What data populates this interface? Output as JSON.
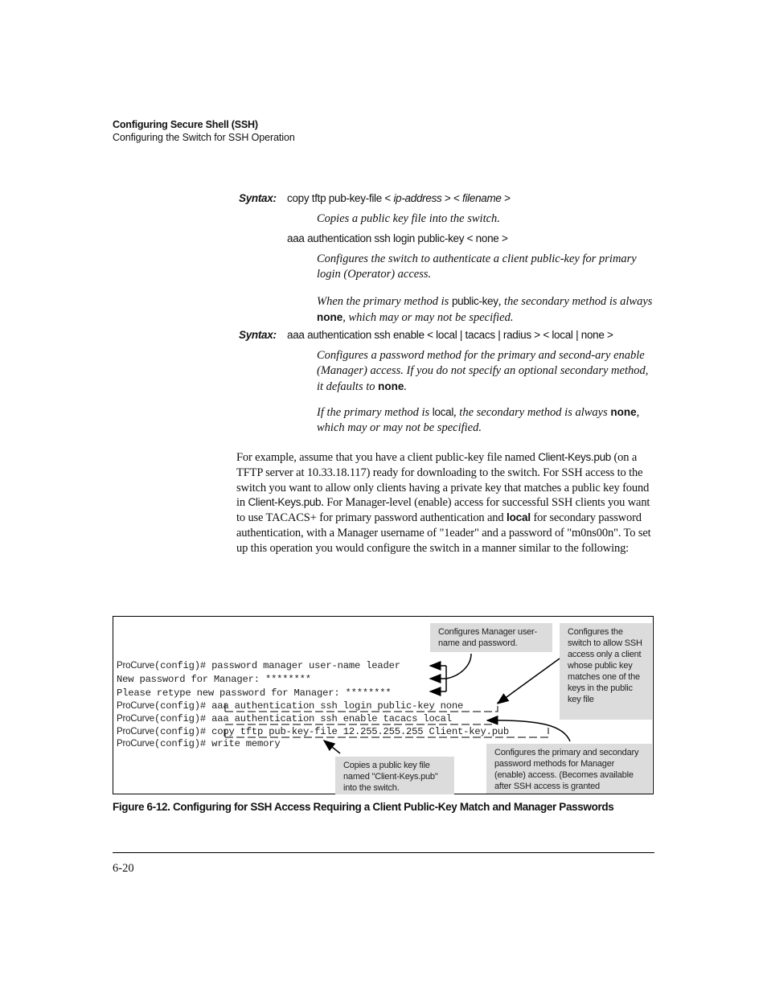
{
  "header": {
    "chapter_title": "Configuring Secure Shell (SSH)",
    "section_title": "Configuring the Switch for SSH Operation"
  },
  "syntax_blocks": [
    {
      "label": "Syntax:",
      "cmd1_prefix": "copy tftp pub-key-file < ",
      "cmd1_arg1": "ip-address",
      "cmd1_mid": " > < ",
      "cmd1_arg2": "filename",
      "cmd1_suffix": " >",
      "desc1": "Copies a public key file into the switch.",
      "cmd2": "aaa authentication ssh login public-key < none >",
      "desc2": "Configures the switch to authenticate a client public-key for primary login (Operator) access.",
      "desc3_a": "When the primary method is ",
      "desc3_kw": "public-key",
      "desc3_b": ", the secondary method is always ",
      "desc3_bold": "none",
      "desc3_c": ", which may or may not be specified."
    },
    {
      "label": "Syntax:",
      "cmd": "aaa authentication ssh enable < local | tacacs | radius > < local | none >",
      "desc1_a": "Configures a password method for the primary and second-ary enable (Manager) access. If you do not specify an optional secondary method, it defaults to ",
      "desc1_bold": "none",
      "desc1_c": ".",
      "desc2_a": "If the primary method is ",
      "desc2_kw": "local",
      "desc2_b": ", the secondary method is always ",
      "desc2_bold": "none",
      "desc2_c": ", which may or may not be specified."
    }
  ],
  "paragraph": {
    "t1": "For example, assume that you have a client public-key file named ",
    "f1": "Client-Keys.pub",
    "t2": " (on a TFTP server at 10.33.18.117) ready for downloading to the switch. For SSH access to the switch you want to allow only clients having a private key that matches a public key found in ",
    "f2": "Client-Keys.pub",
    "t3": ". For Manager-level (enable) access for successful SSH clients you want to use TACACS+ for primary password authentication and ",
    "bold": "local",
    "t4": " for secondary password authentication, with a Manager username of \"1eader\" and a password of \"m0ns00n\". To set up this operation you would configure the switch in a manner similar to the following:"
  },
  "figure": {
    "terminal_lines": [
      {
        "prompt": "ProCurve",
        "rest": "(config)# password manager user-name leader"
      },
      {
        "prompt": "",
        "rest": "New password for Manager: ********"
      },
      {
        "prompt": "",
        "rest": "Please retype new password for Manager: ********"
      },
      {
        "prompt": "ProCurve",
        "rest": "(config)# aaa authentication ssh login public-key none"
      },
      {
        "prompt": "ProCurve",
        "rest": "(config)# aaa authentication ssh enable tacacs local"
      },
      {
        "prompt": "ProCurve",
        "rest": "(config)# copy tftp pub-key-file 12.255.255.255 Client-key.pub"
      },
      {
        "prompt": "ProCurve",
        "rest": "(config)# write memory"
      }
    ],
    "callouts": {
      "manager": "Configures Manager user-name and password.",
      "pubkey": "Configures the switch to allow SSH access only a client whose public key matches one of the keys in the public key file",
      "copy": "Copies a public key file named \"Client-Keys.pub\" into the switch.",
      "enable": "Configures the primary and secondary password methods for Manager (enable) access. (Becomes available after SSH access is granted"
    },
    "caption": "Figure 6-12. Configuring for SSH Access Requiring a Client Public-Key Match and Manager Passwords"
  },
  "footer": {
    "page_number": "6-20"
  }
}
